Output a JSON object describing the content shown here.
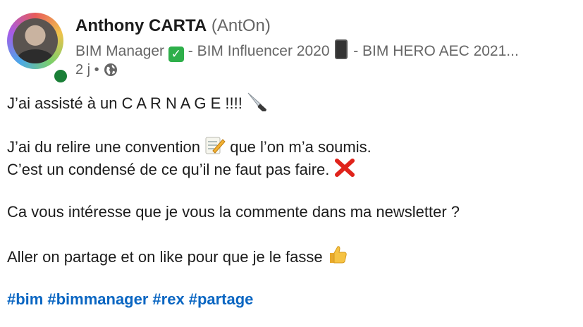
{
  "author": {
    "name": "Anthony CARTA",
    "handle": "(AntOn)",
    "headline_part1": "BIM Manager",
    "headline_part2": "- BIM Influencer 2020",
    "headline_part3": "- BIM HERO AEC 2021...",
    "time": "2 j •"
  },
  "post": {
    "line1": "J’ai assisté à un C A R N A G E !!!!",
    "line2a": "J’ai du relire une convention",
    "line2b": "que l’on m’a soumis.",
    "line3": "C’est un condensé de ce qu’il ne faut pas faire.",
    "line4": "Ca vous intéresse que je vous la commente dans ma newsletter ?",
    "line5": "Aller on partage et on like pour que je le fasse",
    "hashtags": [
      "#bim",
      "#bimmanager",
      "#rex",
      "#partage"
    ]
  },
  "icons": {
    "check": "check-mark-emoji",
    "phone": "mobile-phone-emoji",
    "globe": "globe-icon",
    "knife": "knife-emoji",
    "memo": "memo-emoji",
    "cross": "cross-mark-emoji",
    "thumb": "thumbs-up-emoji"
  },
  "colors": {
    "hashtag": "#0a66c2",
    "online": "#1a7f37",
    "secondary_text": "#666666"
  }
}
